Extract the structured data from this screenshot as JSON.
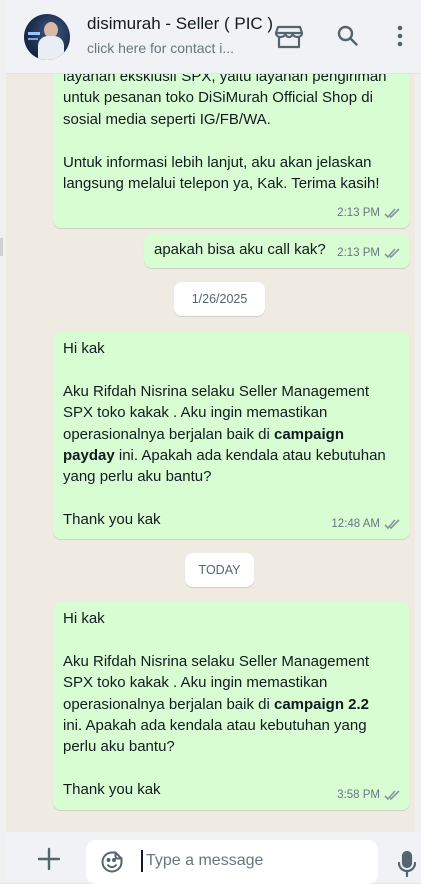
{
  "header": {
    "title": "disimurah - Seller ( PIC )",
    "subtitle": "click here for contact i...",
    "icons": [
      "store-icon",
      "search-icon",
      "more-vert-icon"
    ]
  },
  "messages": [
    {
      "text": "layanan eksklusif SPX, yaitu layanan pengiriman\nuntuk pesanan toko DiSiMurah Official Shop di\nsosial media seperti IG/FB/WA.\n\nUntuk informasi lebih lanjut, aku akan jelaskan\nlangsung melalui telepon ya, Kak. Terima kasih!",
      "time": "2:13 PM",
      "status": "read"
    },
    {
      "text": "apakah bisa aku call kak?",
      "time": "2:13 PM",
      "status": "read"
    },
    {
      "date": "1/26/2025"
    },
    {
      "text_parts": [
        "Hi kak\n\nAku Rifdah Nisrina selaku Seller Management\nSPX toko kakak . Aku ingin memastikan\noperasionalnya berjalan baik di ",
        "campaign\npayday",
        " ini. Apakah ada kendala atau kebutuhan\nyang perlu aku bantu?\n\nThank you kak"
      ],
      "time": "12:48 AM",
      "status": "read"
    },
    {
      "date": "TODAY"
    },
    {
      "text_parts": [
        "Hi kak\n\nAku Rifdah Nisrina selaku Seller Management\nSPX toko kakak . Aku ingin memastikan\noperasionalnya berjalan baik di ",
        "campaign 2.2",
        "\nini. Apakah ada kendala atau kebutuhan yang\nperlu aku bantu?\n\nThank you kak"
      ],
      "time": "3:58 PM",
      "status": "read"
    }
  ],
  "composer": {
    "placeholder": "Type a message",
    "icons": [
      "plus-icon",
      "emoji-icon",
      "mic-icon"
    ]
  },
  "colors": {
    "outgoing_bubble": "#d9fdd3",
    "chat_background": "#efeae2",
    "header_background": "#f0f2f5",
    "read_tick": "#8696a0"
  }
}
